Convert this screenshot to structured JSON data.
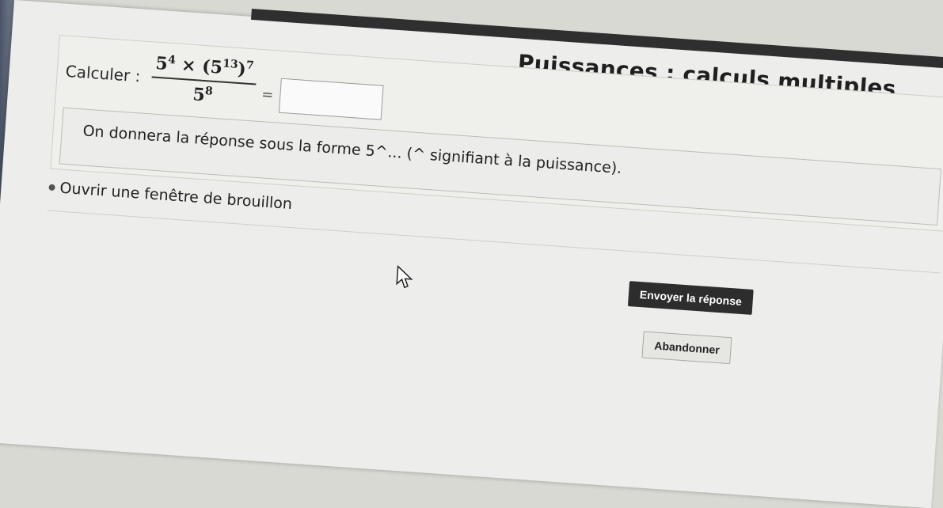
{
  "title": "Puissances : calculs multiples",
  "question": {
    "label": "Calculer :",
    "numerator_base1": "5",
    "numerator_exp1": "4",
    "times": "×",
    "paren_base": "5",
    "paren_inner_exp": "13",
    "paren_outer_exp": "7",
    "denominator_base": "5",
    "denominator_exp": "8",
    "equals": "=",
    "answer_value": ""
  },
  "instruction": "On donnera la réponse sous la forme 5^... (^ signifiant à la puissance).",
  "draft_link": "Ouvrir une fenêtre de brouillon",
  "buttons": {
    "send": "Envoyer la réponse",
    "cancel": "Abandonner"
  },
  "colors": {
    "page_bg": "#ededeb",
    "send_button_bg": "#2d2d2d",
    "cancel_button_bg": "#e6e6e3"
  },
  "icons": {
    "draft": "bullet-icon",
    "pointer": "cursor-icon"
  }
}
